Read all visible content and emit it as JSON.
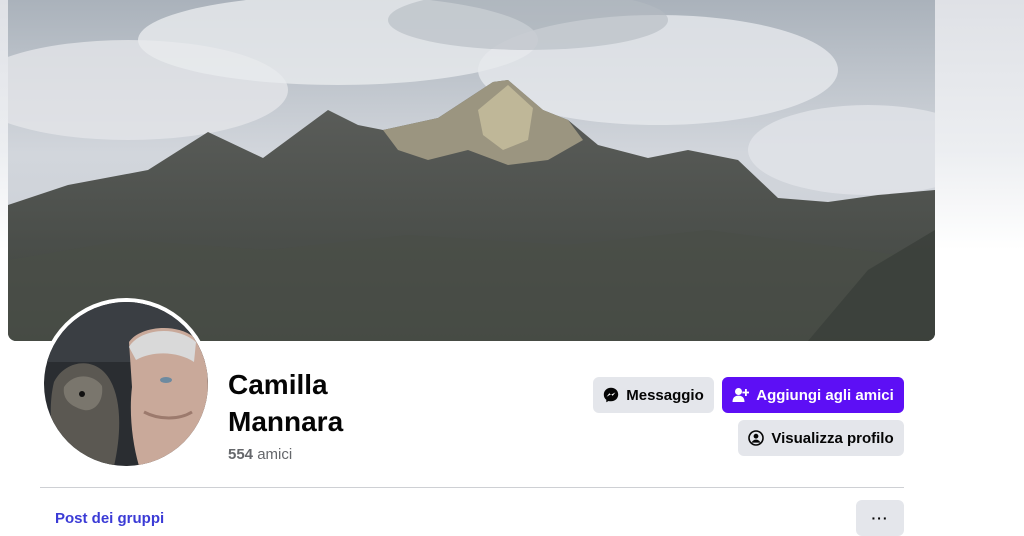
{
  "profile": {
    "first_name": "Camilla",
    "last_name": "Mannara",
    "friends_count": "554",
    "friends_label": "amici"
  },
  "actions": {
    "message_label": "Messaggio",
    "message_icon": "messenger-icon",
    "add_friend_label": "Aggiungi agli amici",
    "add_friend_icon": "add-user-icon",
    "view_profile_label": "Visualizza profilo",
    "view_profile_icon": "user-circle-icon",
    "more_label": "···"
  },
  "tabs": [
    {
      "label": "Post dei gruppi"
    }
  ],
  "colors": {
    "accent": "#5d0ff5",
    "tab_text": "#3b3bd6",
    "secondary_button": "#e4e6eb"
  }
}
